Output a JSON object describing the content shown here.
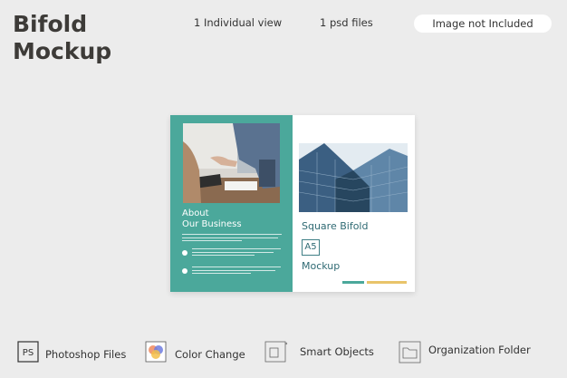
{
  "header": {
    "title_line1": "Bifold",
    "title_line2": "Mockup",
    "views": "1 Individual view",
    "files": "1 psd files",
    "image_note": "Image not Included"
  },
  "brochure": {
    "left_heading_line1": "About",
    "left_heading_line2": "Our Business",
    "right_title": "Square Bifold",
    "right_badge": "A5",
    "right_subtitle": "Mockup",
    "colors": {
      "teal": "#4ba89b",
      "yellow": "#e9c46a",
      "text_teal": "#2f6a73"
    }
  },
  "features": [
    {
      "icon": "ps-icon",
      "icon_text": "PS",
      "label": "Photoshop Files"
    },
    {
      "icon": "color-change-icon",
      "label": "Color Change"
    },
    {
      "icon": "smart-objects-icon",
      "label": "Smart Objects"
    },
    {
      "icon": "folder-icon",
      "label": "Organization Folder"
    }
  ]
}
